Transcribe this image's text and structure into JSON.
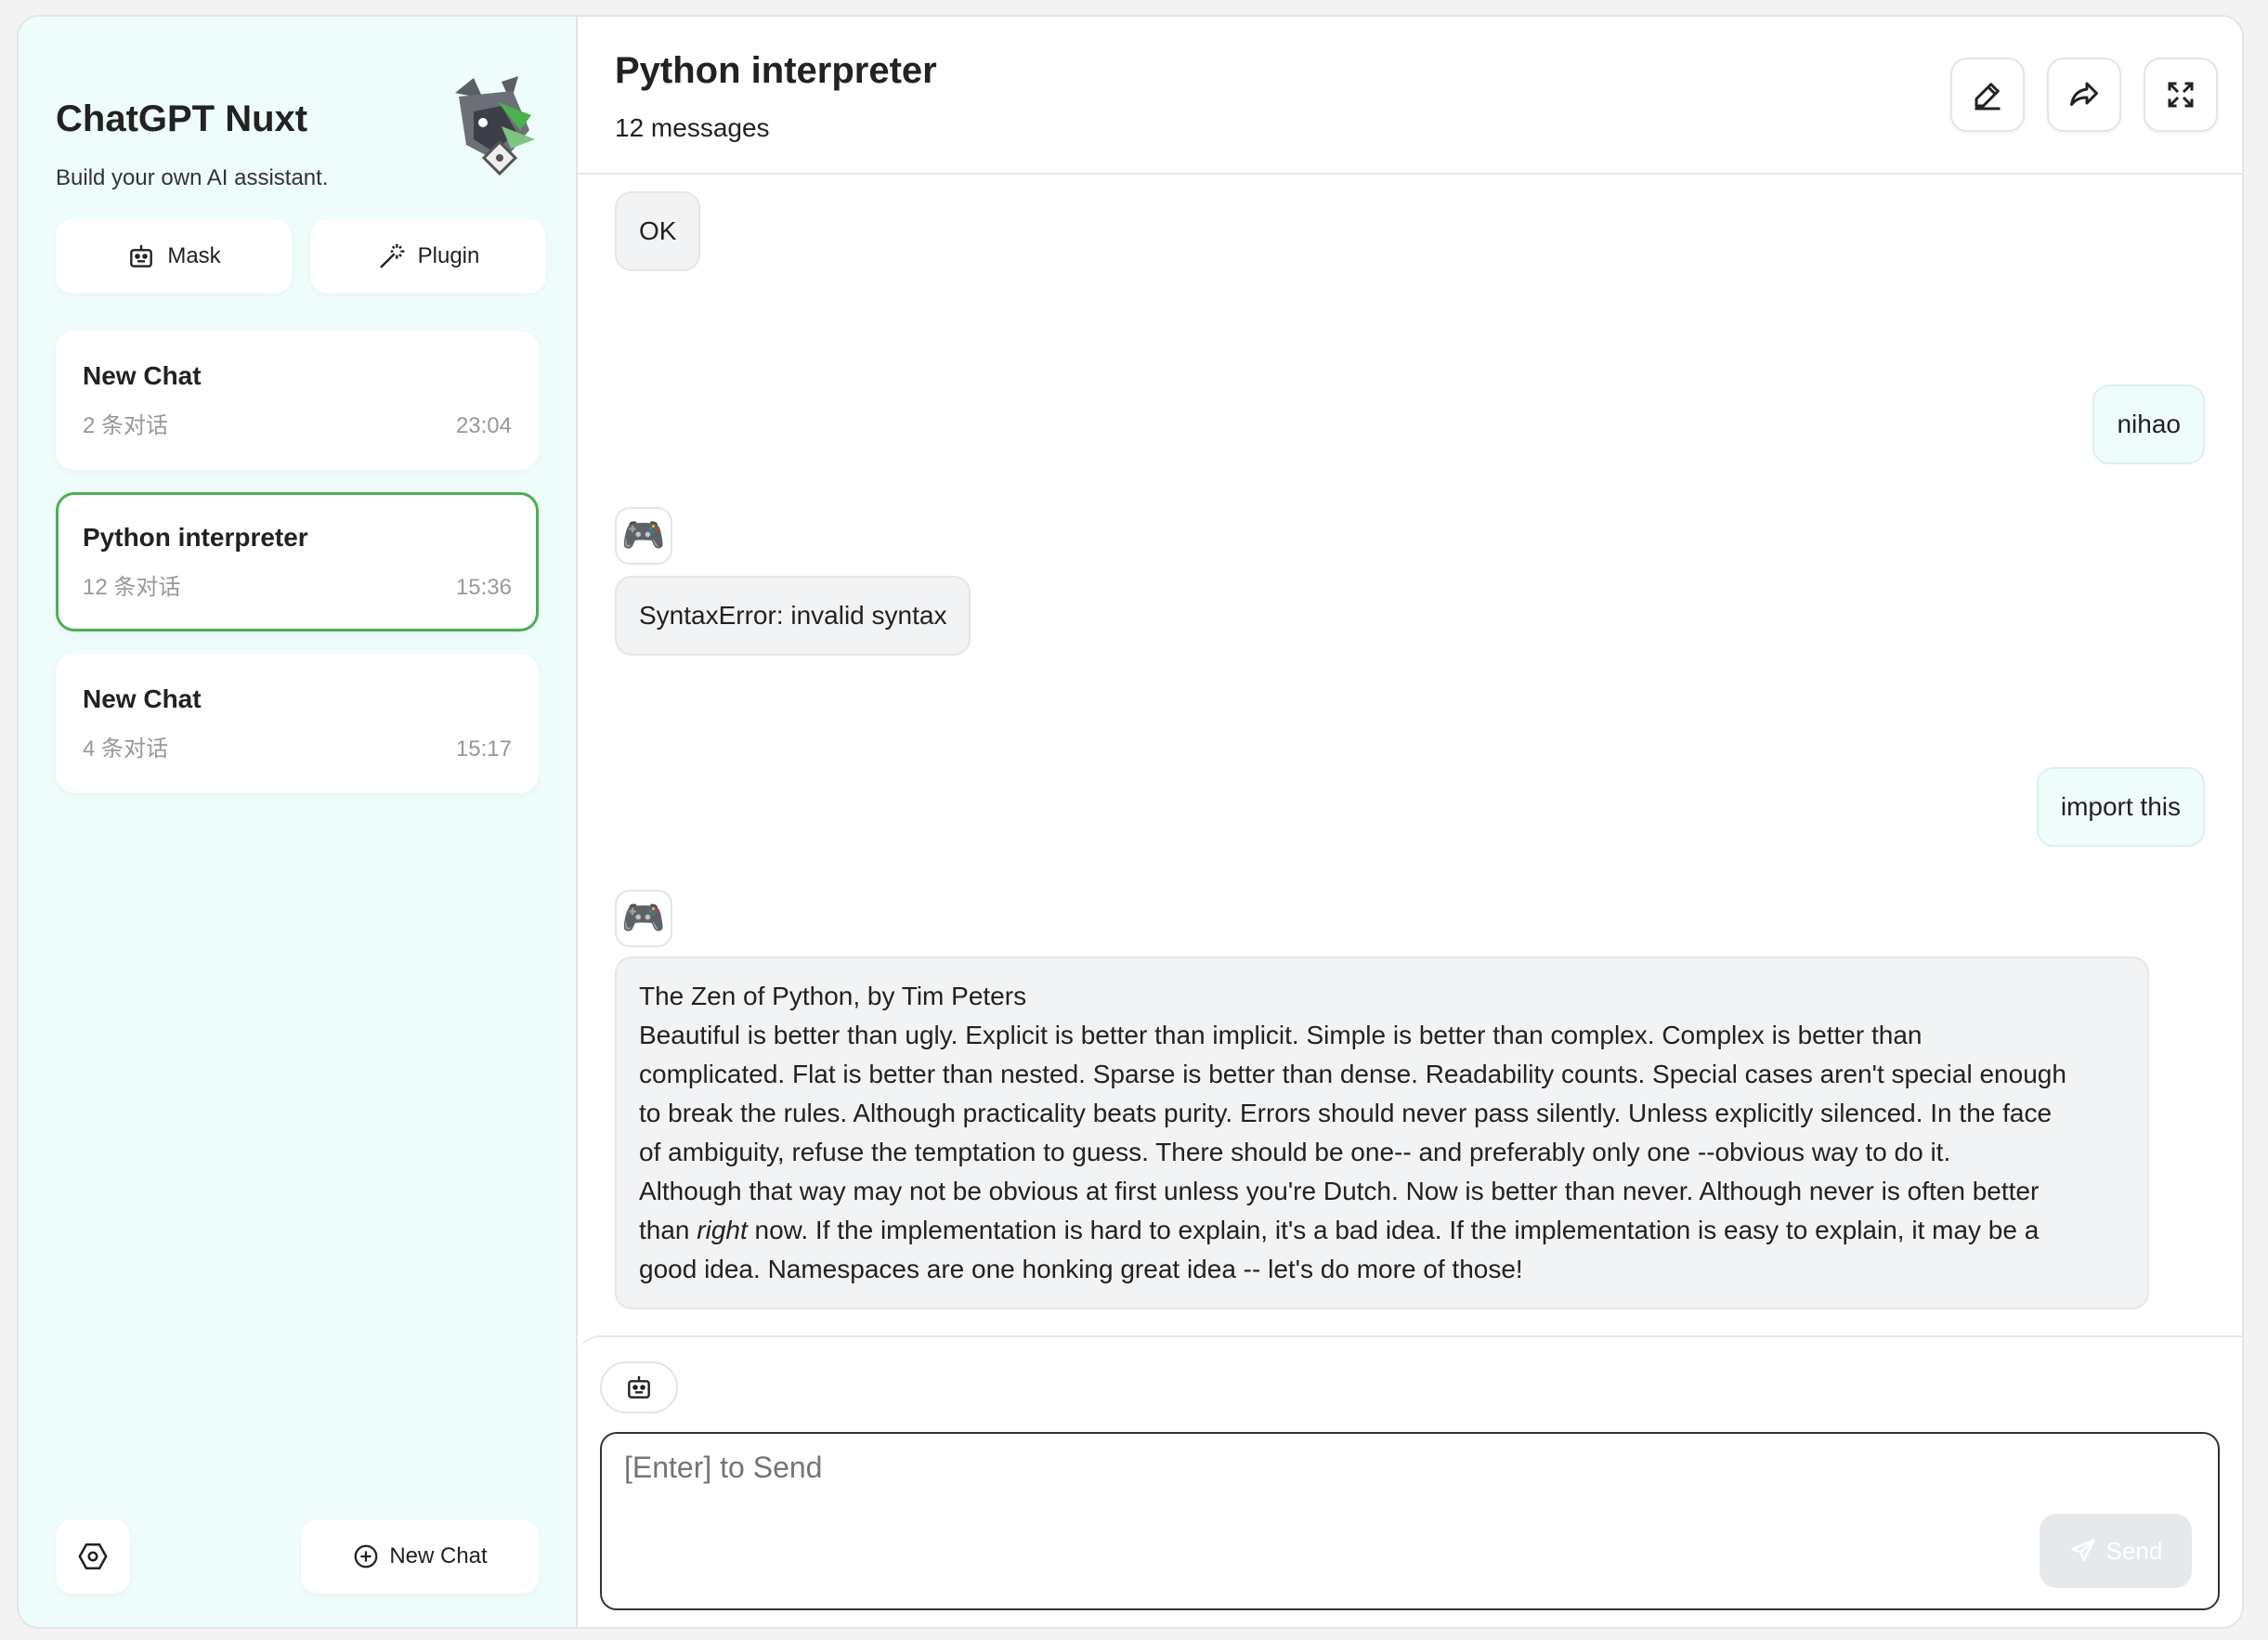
{
  "sidebar": {
    "brand_title": "ChatGPT Nuxt",
    "brand_subtitle": "Build your own AI assistant.",
    "mask_label": "Mask",
    "plugin_label": "Plugin",
    "chats": [
      {
        "title": "New Chat",
        "count": "2 条对话",
        "time": "23:04",
        "active": false
      },
      {
        "title": "Python interpreter",
        "count": "12 条对话",
        "time": "15:36",
        "active": true
      },
      {
        "title": "New Chat",
        "count": "4 条对话",
        "time": "15:17",
        "active": false
      }
    ],
    "new_chat_label": "New Chat"
  },
  "header": {
    "title": "Python interpreter",
    "count": "12 messages"
  },
  "messages": [
    {
      "role": "bot",
      "text": "OK"
    },
    {
      "role": "user",
      "avatar": "🙂",
      "text": "nihao"
    },
    {
      "role": "bot",
      "avatar": "🎮",
      "text": "SyntaxError: invalid syntax"
    },
    {
      "role": "user",
      "avatar": "🙂",
      "text": "import this"
    },
    {
      "role": "bot",
      "avatar": "🎮",
      "text_lines": [
        "The Zen of Python, by Tim Peters",
        "Beautiful is better than ugly. Explicit is better than implicit. Simple is better than complex. Complex is better than",
        "complicated. Flat is better than nested. Sparse is better than dense. Readability counts. Special cases aren't special enough",
        "to break the rules. Although practicality beats purity. Errors should never pass silently. Unless explicitly silenced. In the face",
        "of ambiguity, refuse the temptation to guess. There should be one-- and preferably only one --obvious way to do it.",
        "Although that way may not be obvious at first unless you're Dutch. Now is better than never. Although never is often better"
      ],
      "line7_pre": "than ",
      "line7_em": "right",
      "line7_post": " now. If the implementation is hard to explain, it's a bad idea. If the implementation is easy to explain, it may be a",
      "line8": "good idea. Namespaces are one honking great idea -- let's do more of those!"
    }
  ],
  "input": {
    "placeholder": "[Enter] to Send",
    "send_label": "Send"
  },
  "colors": {
    "sidebar_bg": "#effcfc",
    "active_border": "#4caf50",
    "bot_bubble": "#f2f3f4",
    "user_bubble": "#effcfc"
  }
}
